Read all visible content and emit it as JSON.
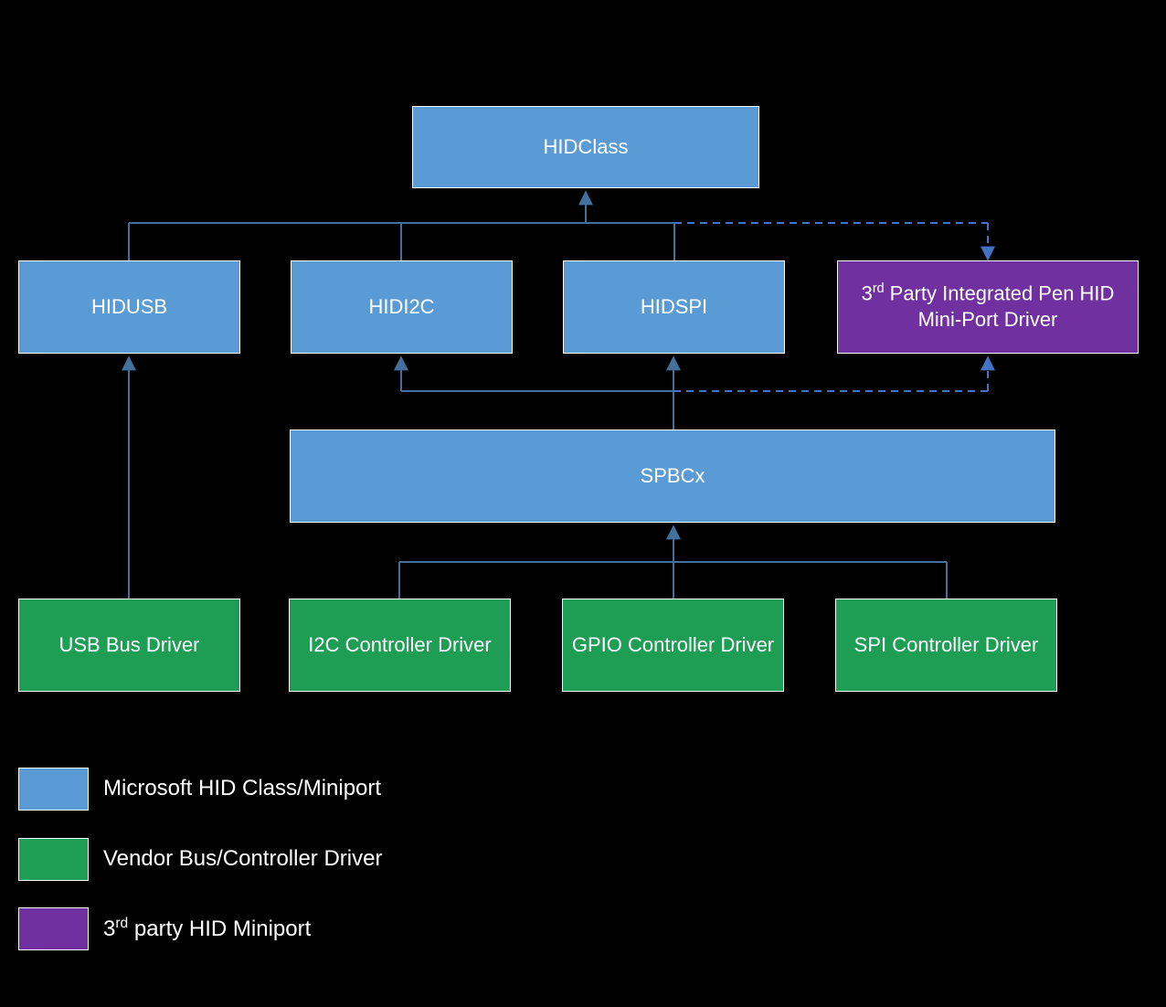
{
  "nodes": {
    "hidclass": "HIDClass",
    "hidusb": "HIDUSB",
    "hidi2c": "HIDI2C",
    "hidspi": "HIDSPI",
    "thirdparty_a": "3",
    "thirdparty_b": "rd",
    "thirdparty_c": " Party Integrated Pen HID Mini-Port Driver",
    "spbcx": "SPBCx",
    "usb_bus": "USB Bus Driver",
    "i2c_ctrl": "I2C Controller Driver",
    "gpio_ctrl": "GPIO Controller Driver",
    "spi_ctrl": "SPI Controller Driver"
  },
  "legend": {
    "ms_class": "Microsoft HID Class/Miniport",
    "vendor": "Vendor Bus/Controller Driver",
    "third": "3",
    "third_sup": "rd",
    "third_rest": " party HID Miniport"
  },
  "colors": {
    "blue": "#5b9bd5",
    "green": "#1e9e54",
    "purple": "#7030a0",
    "stroke": "#41719c",
    "dash": "#4472c4"
  }
}
